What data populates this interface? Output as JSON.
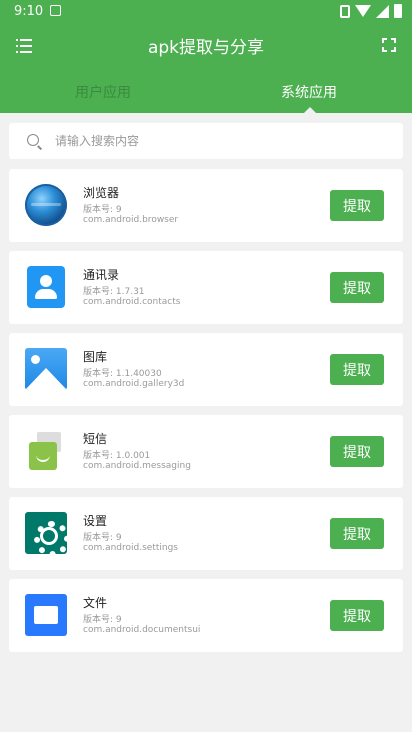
{
  "status_bar": {
    "time": "9:10"
  },
  "toolbar": {
    "title": "apk提取与分享"
  },
  "tabs": [
    {
      "label": "用户应用"
    },
    {
      "label": "系统应用"
    }
  ],
  "search": {
    "placeholder": "请输入搜索内容",
    "value": ""
  },
  "apps": [
    {
      "name": "浏览器",
      "version": "版本号: 9",
      "package": "com.android.browser",
      "icon": "browser-globe-icon",
      "action": "提取"
    },
    {
      "name": "通讯录",
      "version": "版本号: 1.7.31",
      "package": "com.android.contacts",
      "icon": "contacts-icon",
      "action": "提取"
    },
    {
      "name": "图库",
      "version": "版本号: 1.1.40030",
      "package": "com.android.gallery3d",
      "icon": "gallery-icon",
      "action": "提取"
    },
    {
      "name": "短信",
      "version": "版本号: 1.0.001",
      "package": "com.android.messaging",
      "icon": "messaging-icon",
      "action": "提取"
    },
    {
      "name": "设置",
      "version": "版本号: 9",
      "package": "com.android.settings",
      "icon": "settings-gear-icon",
      "action": "提取"
    },
    {
      "name": "文件",
      "version": "版本号: 9",
      "package": "com.android.documentsui",
      "icon": "files-folder-icon",
      "action": "提取"
    }
  ],
  "colors": {
    "primary": "#4caf50",
    "background": "#f1f1f1",
    "tab_inactive": "#3b8a3f"
  }
}
